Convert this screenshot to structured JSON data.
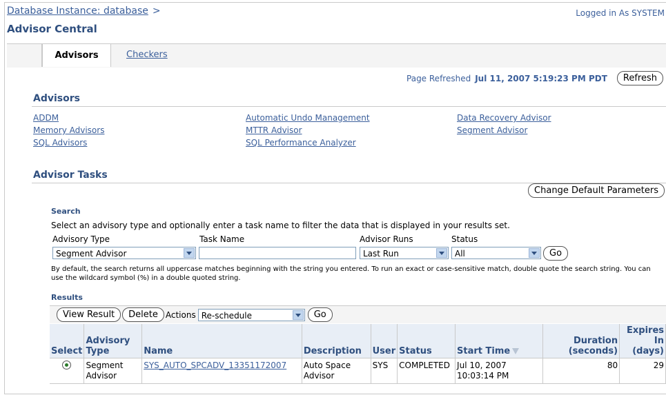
{
  "header": {
    "breadcrumb": "Database Instance: database",
    "breadcrumb_sep": ">",
    "logged_in": "Logged in As SYSTEM",
    "page_title": "Advisor Central"
  },
  "tabs": [
    {
      "label": "Advisors",
      "active": true
    },
    {
      "label": "Checkers",
      "active": false
    }
  ],
  "refresh": {
    "label": "Page Refreshed",
    "value": "Jul 11, 2007 5:19:23 PM PDT",
    "button": "Refresh"
  },
  "advisors": {
    "heading": "Advisors",
    "col1": [
      "ADDM",
      "Memory Advisors",
      "SQL Advisors"
    ],
    "col2": [
      "Automatic Undo Management",
      "MTTR Advisor",
      "SQL Performance Analyzer"
    ],
    "col3": [
      "Data Recovery Advisor",
      "Segment Advisor"
    ]
  },
  "tasks": {
    "heading": "Advisor Tasks",
    "change_button": "Change Default Parameters"
  },
  "search": {
    "heading": "Search",
    "description": "Select an advisory type and optionally enter a task name to filter the data that is displayed in your results set.",
    "advisory_type_label": "Advisory Type",
    "advisory_type_value": "Segment Advisor",
    "task_name_label": "Task Name",
    "task_name_value": "",
    "advisor_runs_label": "Advisor Runs",
    "advisor_runs_value": "Last Run",
    "status_label": "Status",
    "status_value": "All",
    "go_button": "Go",
    "note": "By default, the search returns all uppercase matches beginning with the string you entered. To run an exact or case-sensitive match, double quote the search string. You can use the wildcard symbol (%) in a double quoted string."
  },
  "results": {
    "heading": "Results",
    "view_button": "View Result",
    "delete_button": "Delete",
    "actions_label": "Actions",
    "actions_value": "Re-schedule",
    "go_button": "Go",
    "columns": {
      "select": "Select",
      "advisory_type": "Advisory Type",
      "name": "Name",
      "description": "Description",
      "user": "User",
      "status": "Status",
      "start_time": "Start Time",
      "duration": "Duration (seconds)",
      "expires": "Expires In (days)"
    },
    "rows": [
      {
        "advisory_type": "Segment Advisor",
        "name": "SYS_AUTO_SPCADV_13351172007",
        "description": "Auto Space Advisor",
        "user": "SYS",
        "status": "COMPLETED",
        "start_time": "Jul 10, 2007 10:03:14 PM",
        "duration": "80",
        "expires": "29"
      }
    ]
  }
}
